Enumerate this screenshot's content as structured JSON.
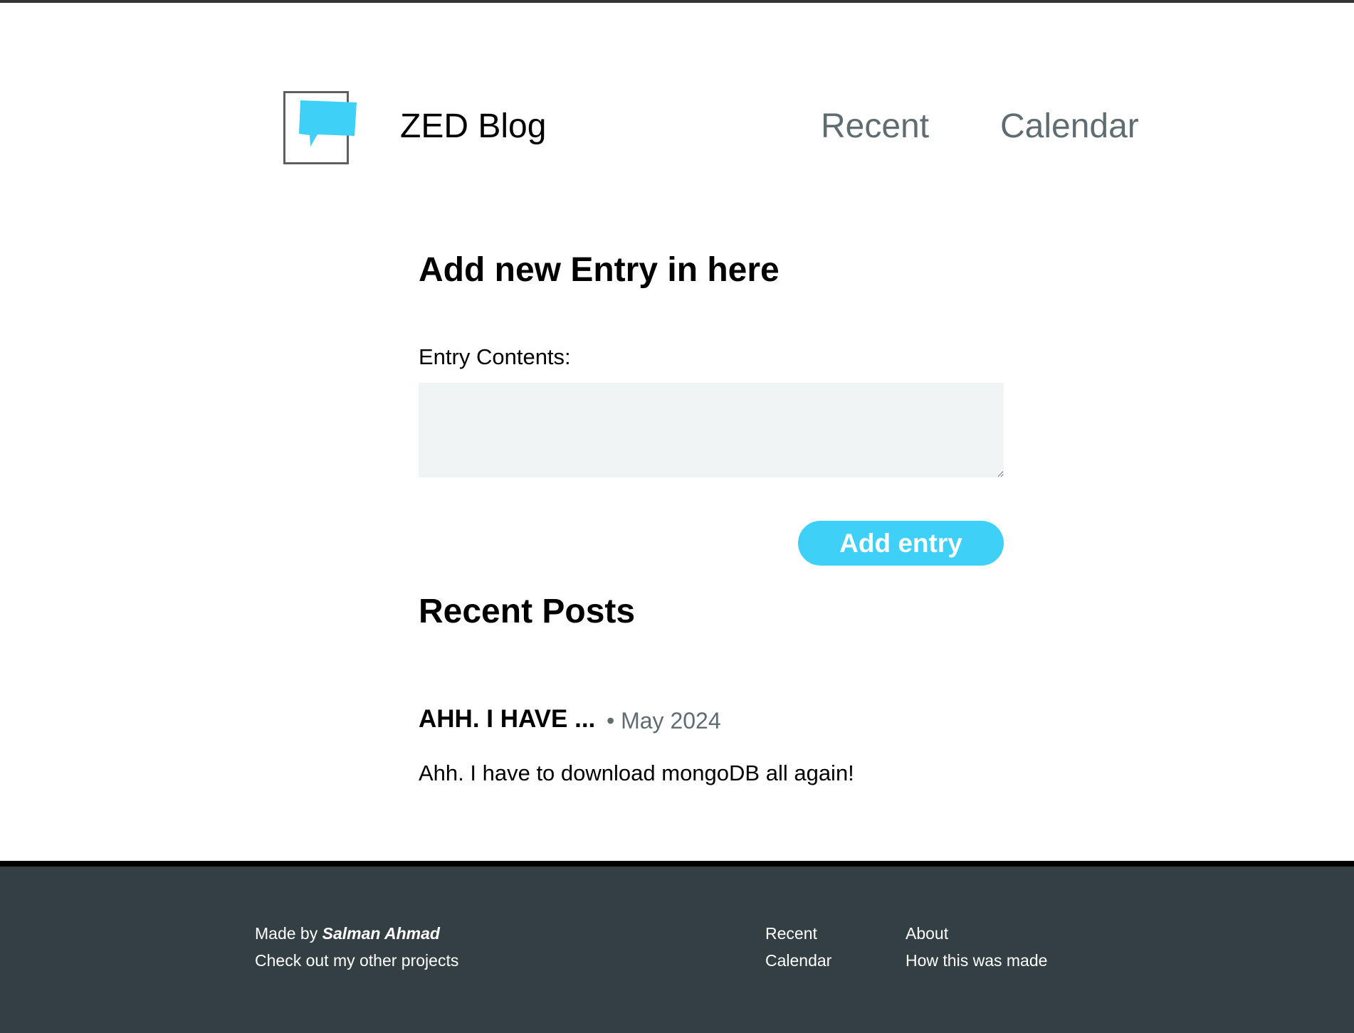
{
  "header": {
    "logo_icon": "speech-bubble-icon",
    "site_title": "ZED Blog",
    "nav": [
      {
        "label": "Recent"
      },
      {
        "label": "Calendar"
      }
    ]
  },
  "form": {
    "heading": "Add new Entry in here",
    "label": "Entry Contents:",
    "textarea_value": "",
    "submit_label": "Add entry"
  },
  "recent": {
    "heading": "Recent Posts",
    "posts": [
      {
        "title": "AHH. I HAVE ...",
        "meta": "• May 2024",
        "body": "Ahh. I have to download mongoDB all again!"
      }
    ]
  },
  "footer": {
    "made_by_prefix": "Made by",
    "author": "Salman Ahmad",
    "other_projects": "Check out my other projects",
    "links_col1": [
      "Recent",
      "Calendar"
    ],
    "links_col2": [
      "About",
      "How this was made"
    ]
  },
  "colors": {
    "accent": "#3fd0f8",
    "footer_bg": "#343f44",
    "nav_text": "#5f6d72",
    "textarea_bg": "#f1f4f4"
  }
}
